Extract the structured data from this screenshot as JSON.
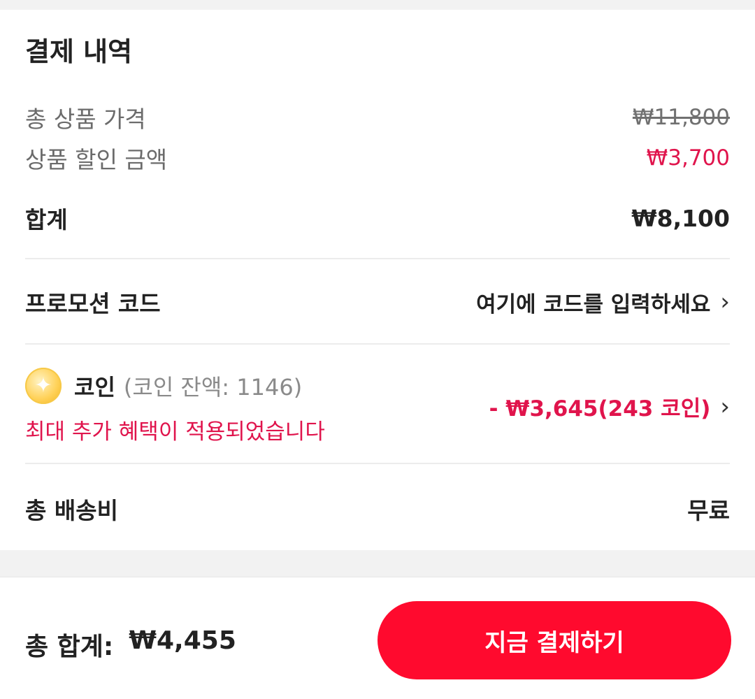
{
  "summary": {
    "title": "결제 내역",
    "total_price_label": "총 상품 가격",
    "total_price_value": "₩11,800",
    "discount_label": "상품 할인 금액",
    "discount_value": "₩3,700",
    "subtotal_label": "합계",
    "subtotal_value": "₩8,100"
  },
  "promo": {
    "label": "프로모션 코드",
    "placeholder": "여기에 코드를 입력하세요"
  },
  "coins": {
    "label": "코인",
    "balance": "(코인 잔액: 1146)",
    "note": "최대 추가 혜택이 적용되었습니다",
    "value": "- ₩3,645(243 코인)"
  },
  "shipping": {
    "label": "총 배송비",
    "value": "무료"
  },
  "footer": {
    "total_label": "총 합계:",
    "total_value": "₩4,455",
    "pay_button": "지금 결제하기"
  },
  "colors": {
    "accent": "#ff0a2e",
    "discount_red": "#e0144c"
  },
  "icons": {
    "coin": "coin-icon",
    "chevron": "chevron-right-icon"
  }
}
